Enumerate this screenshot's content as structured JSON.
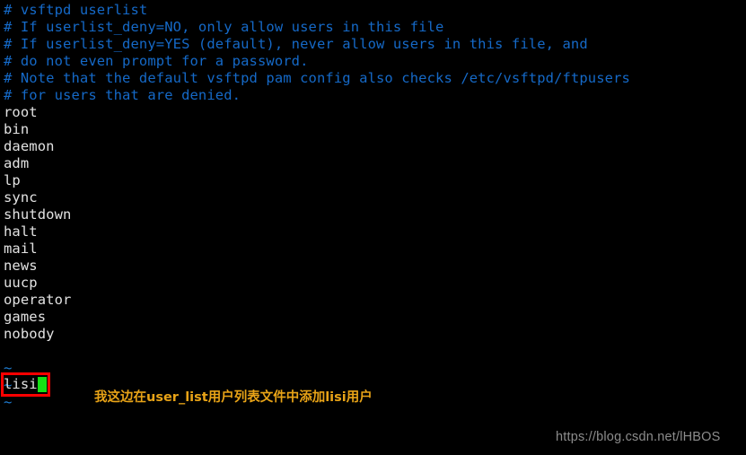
{
  "terminal": {
    "background_color": "#000000",
    "comment_color": "#1569c7",
    "text_color": "#e2e2e2",
    "tilde_color": "#1f7fd6",
    "cursor_color": "#15e015",
    "annotation_box_color": "#ff0000",
    "annotation_text_color": "#e8a317",
    "watermark_color": "#8c8c8c"
  },
  "lines": [
    {
      "type": "comment",
      "text": "# vsftpd userlist"
    },
    {
      "type": "comment",
      "text": "# If userlist_deny=NO, only allow users in this file"
    },
    {
      "type": "comment",
      "text": "# If userlist_deny=YES (default), never allow users in this file, and"
    },
    {
      "type": "comment",
      "text": "# do not even prompt for a password."
    },
    {
      "type": "comment",
      "text": "# Note that the default vsftpd pam config also checks /etc/vsftpd/ftpusers"
    },
    {
      "type": "comment",
      "text": "# for users that are denied."
    },
    {
      "type": "user",
      "text": "root"
    },
    {
      "type": "user",
      "text": "bin"
    },
    {
      "type": "user",
      "text": "daemon"
    },
    {
      "type": "user",
      "text": "adm"
    },
    {
      "type": "user",
      "text": "lp"
    },
    {
      "type": "user",
      "text": "sync"
    },
    {
      "type": "user",
      "text": "shutdown"
    },
    {
      "type": "user",
      "text": "halt"
    },
    {
      "type": "user",
      "text": "mail"
    },
    {
      "type": "user",
      "text": "news"
    },
    {
      "type": "user",
      "text": "uucp"
    },
    {
      "type": "user",
      "text": "operator"
    },
    {
      "type": "user",
      "text": "games"
    },
    {
      "type": "user",
      "text": "nobody"
    },
    {
      "type": "spacer",
      "text": " "
    },
    {
      "type": "tilde",
      "text": "~"
    },
    {
      "type": "tilde",
      "text": "~"
    },
    {
      "type": "tilde",
      "text": "~"
    }
  ],
  "edited_line": {
    "text": "lisi",
    "cursor": "block-cursor"
  },
  "annotation": {
    "text": "我这边在user_list用户列表文件中添加lisi用户"
  },
  "watermark": {
    "text": "https://blog.csdn.net/lHBOS"
  }
}
